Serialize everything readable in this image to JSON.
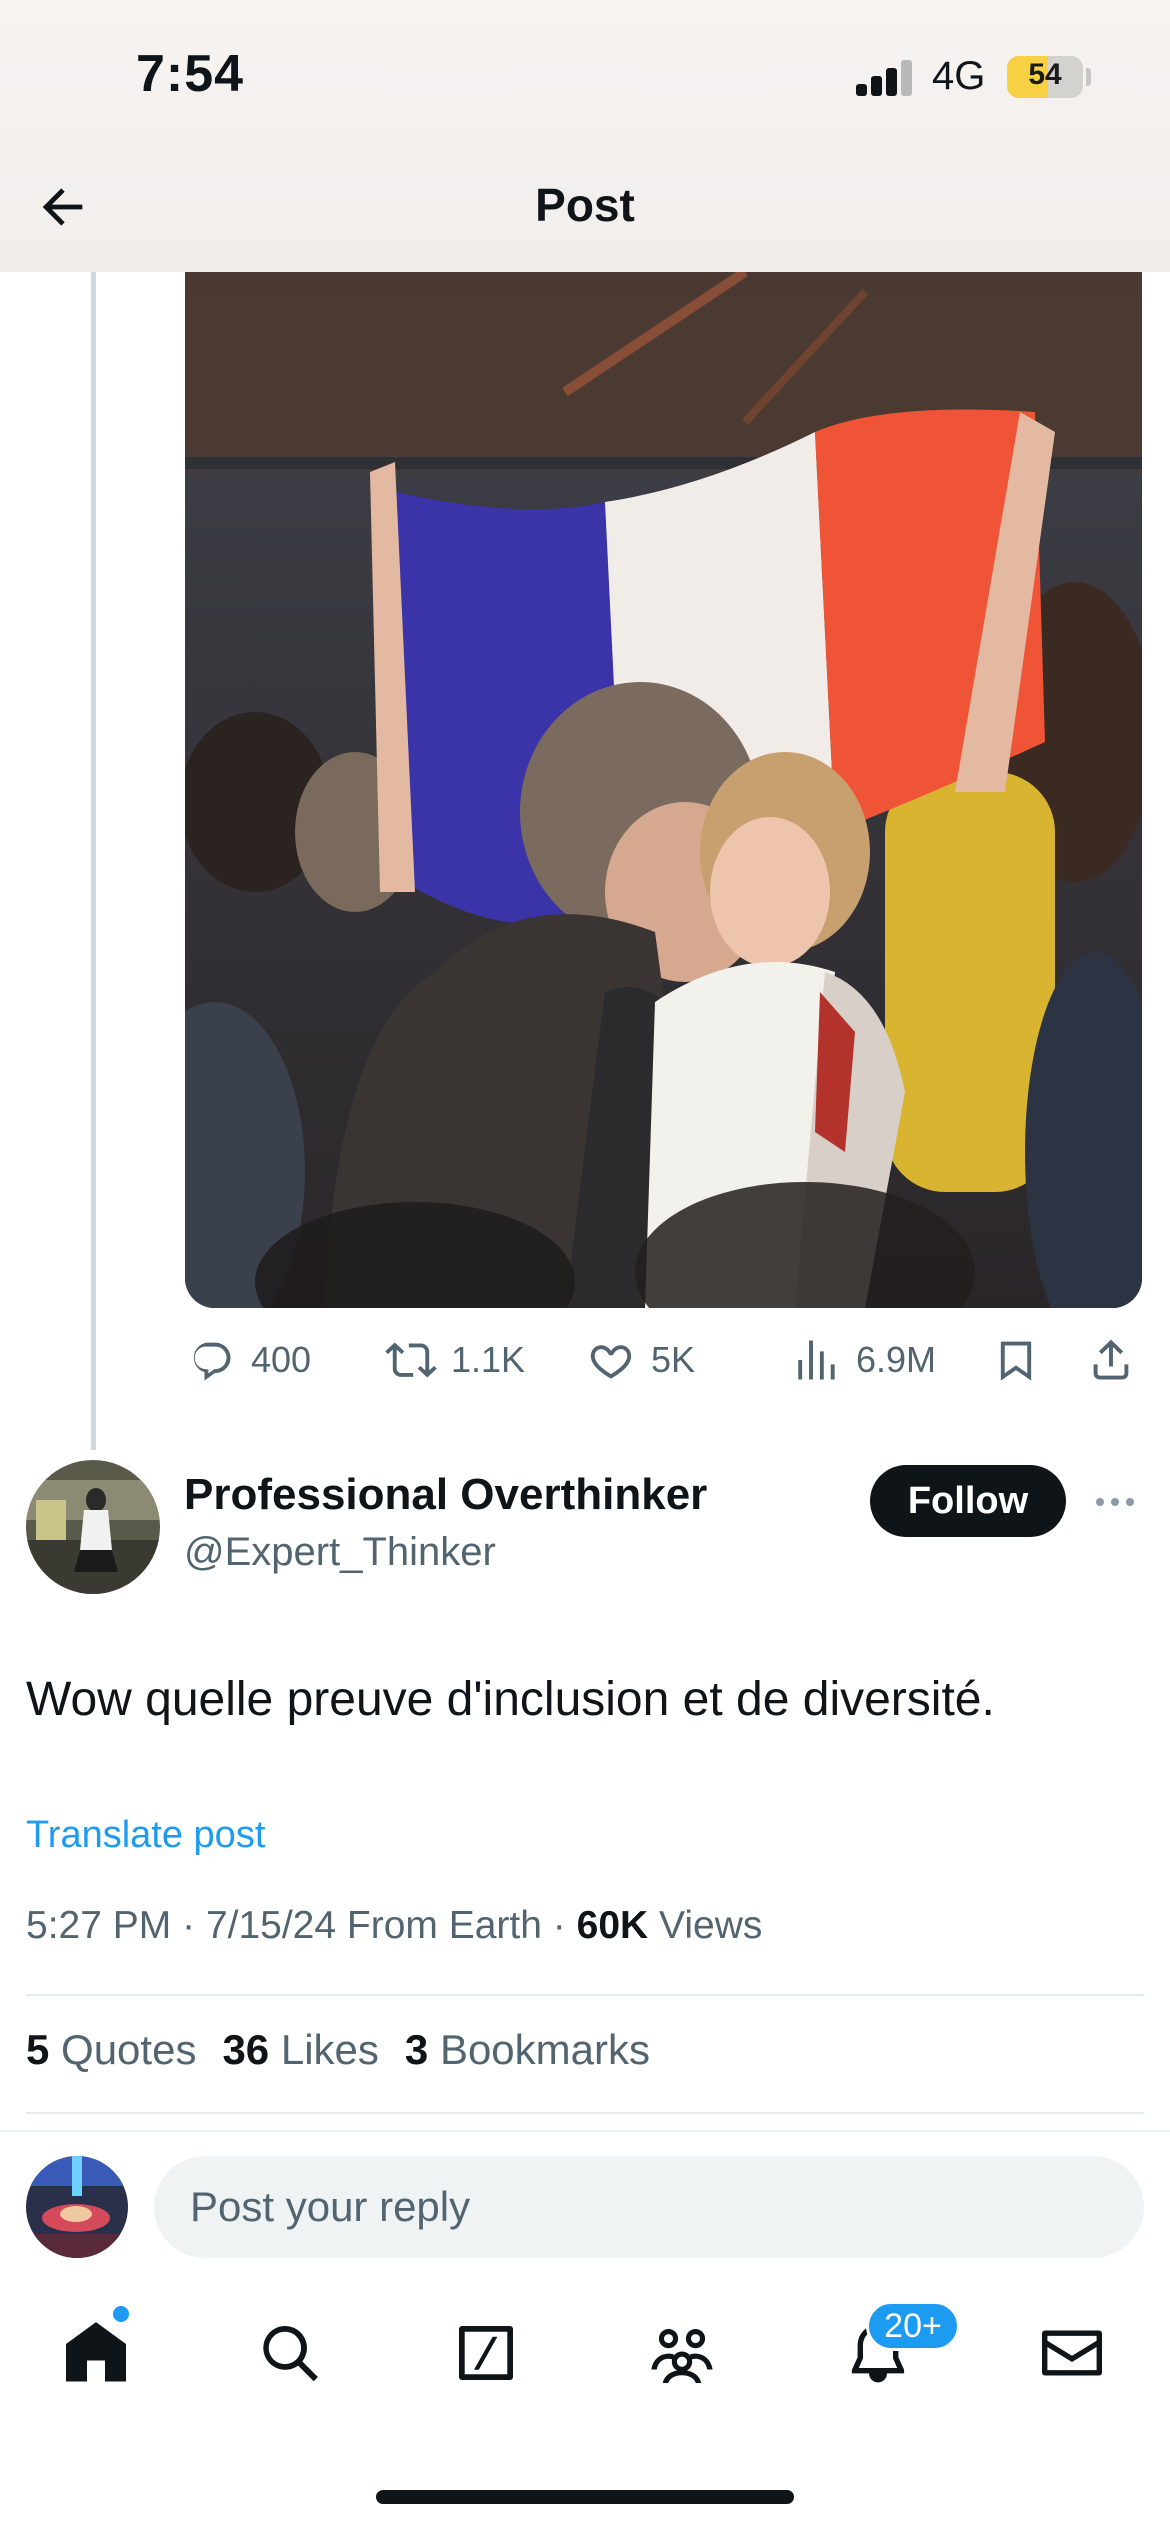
{
  "status_bar": {
    "time": "7:54",
    "network": "4G",
    "battery_label": "54",
    "battery_level": 0.54,
    "signal_bars_active": 3,
    "signal_bars_total": 4
  },
  "header": {
    "back_icon": "arrow-left-icon",
    "title": "Post"
  },
  "quoted_post": {
    "image_description_icon": "photo",
    "actions": {
      "replies": "400",
      "reposts": "1.1K",
      "likes": "5K",
      "views": "6.9M"
    }
  },
  "post": {
    "display_name": "Professional Overthinker",
    "handle": "@Expert_Thinker",
    "follow_label": "Follow",
    "text": "Wow quelle preuve d'inclusion et de diversité.",
    "translate_label": "Translate post",
    "time": "5:27 PM",
    "date": "7/15/24",
    "source": "From Earth",
    "separator": "·",
    "views_count": "60K",
    "views_label": "Views",
    "stats": {
      "quotes_count": "5",
      "quotes_label": "Quotes",
      "likes_count": "36",
      "likes_label": "Likes",
      "bookmarks_count": "3",
      "bookmarks_label": "Bookmarks"
    }
  },
  "reply": {
    "placeholder": "Post your reply"
  },
  "tab_bar": {
    "items": [
      "home-icon",
      "search-icon",
      "grok-icon",
      "communities-icon",
      "notifications-icon",
      "messages-icon"
    ],
    "notifications_badge": "20+"
  },
  "colors": {
    "accent": "#1d9bf0",
    "text": "#0f1419",
    "secondary_text": "#536471"
  }
}
